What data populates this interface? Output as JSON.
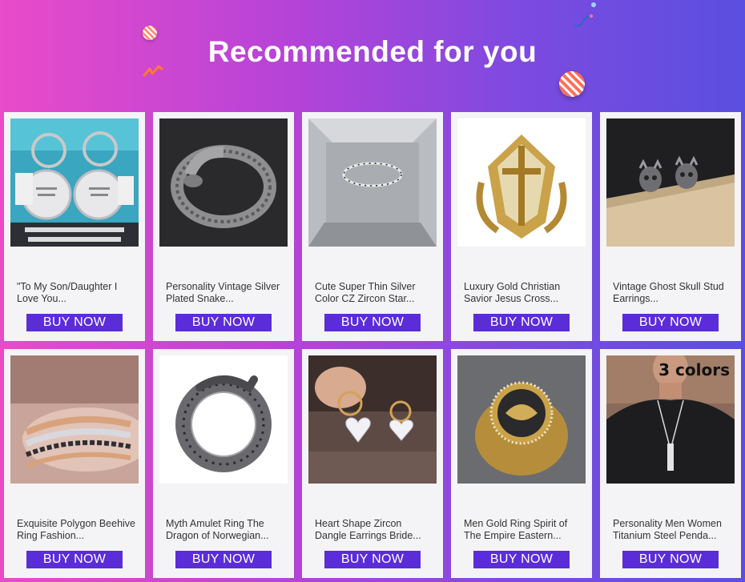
{
  "header": {
    "title": "Recommended for you"
  },
  "products": [
    {
      "name": "\"To My Son/Daughter I Love You...",
      "button": "BUY NOW",
      "image_icon": "keychain-image"
    },
    {
      "name": "Personality Vintage Silver Plated Snake...",
      "button": "BUY NOW",
      "image_icon": "snake-ring-image"
    },
    {
      "name": "Cute Super Thin Silver Color CZ Zircon Star...",
      "button": "BUY NOW",
      "image_icon": "thin-ring-image"
    },
    {
      "name": "Luxury Gold Christian Savior Jesus Cross...",
      "button": "BUY NOW",
      "image_icon": "gold-cross-ring-image"
    },
    {
      "name": "Vintage Ghost Skull Stud Earrings...",
      "button": "BUY NOW",
      "image_icon": "skull-earrings-image"
    },
    {
      "name": "Exquisite Polygon Beehive Ring Fashion...",
      "button": "BUY NOW",
      "image_icon": "beehive-ring-image"
    },
    {
      "name": "Myth Amulet Ring The Dragon of Norwegian...",
      "button": "BUY NOW",
      "image_icon": "dragon-ring-image"
    },
    {
      "name": "Heart Shape Zircon Dangle Earrings Bride...",
      "button": "BUY NOW",
      "image_icon": "heart-earrings-image"
    },
    {
      "name": "Men Gold Ring Spirit of The Empire Eastern...",
      "button": "BUY NOW",
      "image_icon": "eagle-ring-image"
    },
    {
      "name": "Personality Men Women Titanium Steel Penda...",
      "button": "BUY NOW",
      "image_icon": "pendant-necklace-image",
      "badge": "3 colors"
    }
  ]
}
